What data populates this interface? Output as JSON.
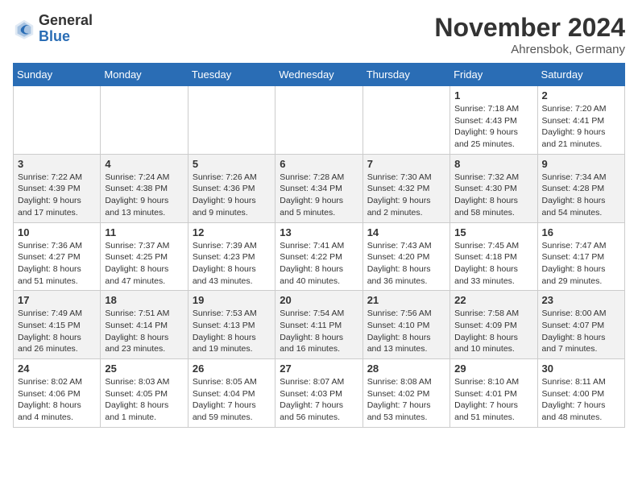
{
  "logo": {
    "general": "General",
    "blue": "Blue"
  },
  "title": "November 2024",
  "location": "Ahrensbok, Germany",
  "days_of_week": [
    "Sunday",
    "Monday",
    "Tuesday",
    "Wednesday",
    "Thursday",
    "Friday",
    "Saturday"
  ],
  "weeks": [
    [
      null,
      null,
      null,
      null,
      null,
      {
        "day": "1",
        "sunrise": "Sunrise: 7:18 AM",
        "sunset": "Sunset: 4:43 PM",
        "daylight": "Daylight: 9 hours and 25 minutes."
      },
      {
        "day": "2",
        "sunrise": "Sunrise: 7:20 AM",
        "sunset": "Sunset: 4:41 PM",
        "daylight": "Daylight: 9 hours and 21 minutes."
      }
    ],
    [
      {
        "day": "3",
        "sunrise": "Sunrise: 7:22 AM",
        "sunset": "Sunset: 4:39 PM",
        "daylight": "Daylight: 9 hours and 17 minutes."
      },
      {
        "day": "4",
        "sunrise": "Sunrise: 7:24 AM",
        "sunset": "Sunset: 4:38 PM",
        "daylight": "Daylight: 9 hours and 13 minutes."
      },
      {
        "day": "5",
        "sunrise": "Sunrise: 7:26 AM",
        "sunset": "Sunset: 4:36 PM",
        "daylight": "Daylight: 9 hours and 9 minutes."
      },
      {
        "day": "6",
        "sunrise": "Sunrise: 7:28 AM",
        "sunset": "Sunset: 4:34 PM",
        "daylight": "Daylight: 9 hours and 5 minutes."
      },
      {
        "day": "7",
        "sunrise": "Sunrise: 7:30 AM",
        "sunset": "Sunset: 4:32 PM",
        "daylight": "Daylight: 9 hours and 2 minutes."
      },
      {
        "day": "8",
        "sunrise": "Sunrise: 7:32 AM",
        "sunset": "Sunset: 4:30 PM",
        "daylight": "Daylight: 8 hours and 58 minutes."
      },
      {
        "day": "9",
        "sunrise": "Sunrise: 7:34 AM",
        "sunset": "Sunset: 4:28 PM",
        "daylight": "Daylight: 8 hours and 54 minutes."
      }
    ],
    [
      {
        "day": "10",
        "sunrise": "Sunrise: 7:36 AM",
        "sunset": "Sunset: 4:27 PM",
        "daylight": "Daylight: 8 hours and 51 minutes."
      },
      {
        "day": "11",
        "sunrise": "Sunrise: 7:37 AM",
        "sunset": "Sunset: 4:25 PM",
        "daylight": "Daylight: 8 hours and 47 minutes."
      },
      {
        "day": "12",
        "sunrise": "Sunrise: 7:39 AM",
        "sunset": "Sunset: 4:23 PM",
        "daylight": "Daylight: 8 hours and 43 minutes."
      },
      {
        "day": "13",
        "sunrise": "Sunrise: 7:41 AM",
        "sunset": "Sunset: 4:22 PM",
        "daylight": "Daylight: 8 hours and 40 minutes."
      },
      {
        "day": "14",
        "sunrise": "Sunrise: 7:43 AM",
        "sunset": "Sunset: 4:20 PM",
        "daylight": "Daylight: 8 hours and 36 minutes."
      },
      {
        "day": "15",
        "sunrise": "Sunrise: 7:45 AM",
        "sunset": "Sunset: 4:18 PM",
        "daylight": "Daylight: 8 hours and 33 minutes."
      },
      {
        "day": "16",
        "sunrise": "Sunrise: 7:47 AM",
        "sunset": "Sunset: 4:17 PM",
        "daylight": "Daylight: 8 hours and 29 minutes."
      }
    ],
    [
      {
        "day": "17",
        "sunrise": "Sunrise: 7:49 AM",
        "sunset": "Sunset: 4:15 PM",
        "daylight": "Daylight: 8 hours and 26 minutes."
      },
      {
        "day": "18",
        "sunrise": "Sunrise: 7:51 AM",
        "sunset": "Sunset: 4:14 PM",
        "daylight": "Daylight: 8 hours and 23 minutes."
      },
      {
        "day": "19",
        "sunrise": "Sunrise: 7:53 AM",
        "sunset": "Sunset: 4:13 PM",
        "daylight": "Daylight: 8 hours and 19 minutes."
      },
      {
        "day": "20",
        "sunrise": "Sunrise: 7:54 AM",
        "sunset": "Sunset: 4:11 PM",
        "daylight": "Daylight: 8 hours and 16 minutes."
      },
      {
        "day": "21",
        "sunrise": "Sunrise: 7:56 AM",
        "sunset": "Sunset: 4:10 PM",
        "daylight": "Daylight: 8 hours and 13 minutes."
      },
      {
        "day": "22",
        "sunrise": "Sunrise: 7:58 AM",
        "sunset": "Sunset: 4:09 PM",
        "daylight": "Daylight: 8 hours and 10 minutes."
      },
      {
        "day": "23",
        "sunrise": "Sunrise: 8:00 AM",
        "sunset": "Sunset: 4:07 PM",
        "daylight": "Daylight: 8 hours and 7 minutes."
      }
    ],
    [
      {
        "day": "24",
        "sunrise": "Sunrise: 8:02 AM",
        "sunset": "Sunset: 4:06 PM",
        "daylight": "Daylight: 8 hours and 4 minutes."
      },
      {
        "day": "25",
        "sunrise": "Sunrise: 8:03 AM",
        "sunset": "Sunset: 4:05 PM",
        "daylight": "Daylight: 8 hours and 1 minute."
      },
      {
        "day": "26",
        "sunrise": "Sunrise: 8:05 AM",
        "sunset": "Sunset: 4:04 PM",
        "daylight": "Daylight: 7 hours and 59 minutes."
      },
      {
        "day": "27",
        "sunrise": "Sunrise: 8:07 AM",
        "sunset": "Sunset: 4:03 PM",
        "daylight": "Daylight: 7 hours and 56 minutes."
      },
      {
        "day": "28",
        "sunrise": "Sunrise: 8:08 AM",
        "sunset": "Sunset: 4:02 PM",
        "daylight": "Daylight: 7 hours and 53 minutes."
      },
      {
        "day": "29",
        "sunrise": "Sunrise: 8:10 AM",
        "sunset": "Sunset: 4:01 PM",
        "daylight": "Daylight: 7 hours and 51 minutes."
      },
      {
        "day": "30",
        "sunrise": "Sunrise: 8:11 AM",
        "sunset": "Sunset: 4:00 PM",
        "daylight": "Daylight: 7 hours and 48 minutes."
      }
    ]
  ]
}
